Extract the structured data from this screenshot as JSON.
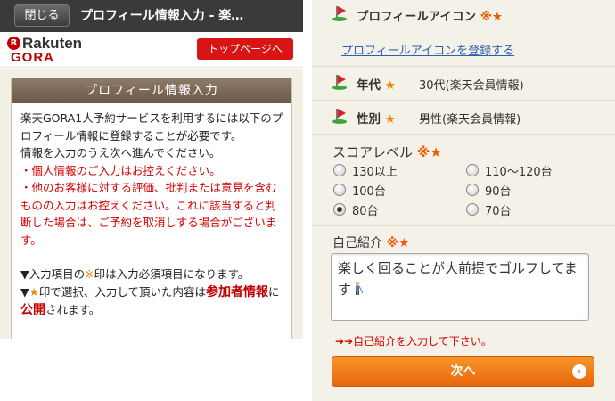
{
  "left": {
    "close_button": "閉じる",
    "title": "プロフィール情報入力 - 楽…",
    "logo": {
      "rakuten": "Rakuten",
      "gora": "GORA"
    },
    "top_page_button": "トップページへ",
    "panel_title": "プロフィール情報入力",
    "paragraphs": {
      "p1": "楽天GORA1人予約サービスを利用するには以下のプロフィール情報に登録することが必要です。",
      "p2": "情報を入力のうえ次へ進んでください。",
      "p3": "・個人情報のご入力はお控えください。",
      "p4": "・他のお客様に対する評価、批判または意見を含むものの入力はお控えください。これに該当すると判断した場合は、ご予約を取消しする場合がございます。",
      "p5_pre": "▼入力項目の",
      "p5_mark": "※",
      "p5_post": "印は入力必須項目になります。",
      "p6_pre": "▼",
      "p6_star": "★",
      "p6_mid": "印で選択、入力して頂いた内容は",
      "p6_b1": "参加者情報",
      "p6_mid2": "に",
      "p6_b2": "公開",
      "p6_post": "されます。"
    }
  },
  "right": {
    "icon_row": {
      "label": "プロフィールアイコン",
      "req": "※★",
      "link": "プロフィールアイコンを登録する"
    },
    "age_row": {
      "label": "年代",
      "star": "★",
      "value": "30代(楽天会員情報)"
    },
    "gender_row": {
      "label": "性別",
      "star": "★",
      "value": "男性(楽天会員情報)"
    },
    "score": {
      "label": "スコアレベル",
      "req": "※★",
      "options": [
        "130以上",
        "110〜120台",
        "100台",
        "90台",
        "80台",
        "70台"
      ],
      "selected": "80台"
    },
    "intro": {
      "label": "自己紹介",
      "req": "※★",
      "value": "楽しく回ることが大前提でゴルフしてます"
    },
    "hint": "➔➔自己紹介を入力して下さい。",
    "next_button": "次へ",
    "next_arrow": "›"
  },
  "icons": [
    "golf-flag-icon",
    "golfer-emoji-icon",
    "arrow-right-icon"
  ],
  "colors": {
    "accent_red": "#d40000",
    "brand_red": "#bf0000",
    "orange": "#f08a00",
    "button_orange": "#e8650b",
    "link_blue": "#2a5fb0"
  }
}
